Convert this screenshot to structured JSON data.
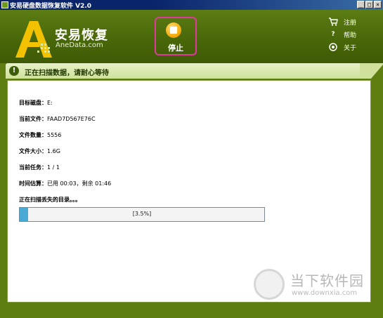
{
  "window": {
    "title": "安易硬盘数据恢复软件 V2.0",
    "buttons": [
      "_",
      "□",
      "×"
    ]
  },
  "header": {
    "brand_cn": "安易恢复",
    "brand_en": "AneData.com",
    "stop_label": "停止",
    "menu": [
      {
        "label": "注册",
        "icon": "cart-icon"
      },
      {
        "label": "帮助",
        "icon": "question-icon"
      },
      {
        "label": "关于",
        "icon": "info-icon"
      }
    ]
  },
  "status": {
    "icon": "info-icon",
    "text": "正在扫描数据，请耐心等待"
  },
  "details": {
    "disk_label": "目标磁盘：",
    "disk_value": "E:",
    "file_label": "当前文件：",
    "file_value": "FAAD7D567E76C",
    "count_label": "文件数量：",
    "count_value": "5556",
    "size_label": "文件大小：",
    "size_value": "1.6G",
    "task_label": "当前任务：",
    "task_value": "1 / 1",
    "time_label": "时间估算：",
    "time_value": "已用 00:03，剩余 01:46",
    "scan_message": "正在扫描丢失的目录。。。"
  },
  "progress": {
    "percent": 3.5,
    "text": "[3.5%]"
  },
  "watermark": {
    "cn": "当下软件园",
    "en": "www.downxia.com"
  },
  "colors": {
    "header_green": "#476608",
    "frame_green": "#5e7e12",
    "status_bg": "#dcebb4",
    "progress_fill": "#4aa9d4",
    "stop_highlight": "#e0399e"
  }
}
